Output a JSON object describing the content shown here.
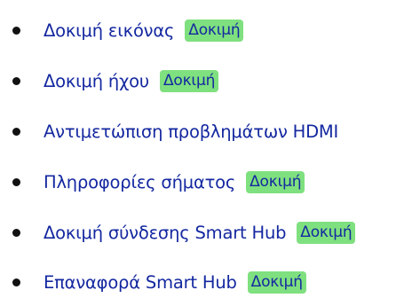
{
  "colors": {
    "link": "#1428a0",
    "badge_background": "#7fe07f",
    "bullet": "#111111"
  },
  "items": [
    {
      "label": "Δοκιμή εικόνας",
      "badge": "Δοκιμή"
    },
    {
      "label": "Δοκιμή ήχου",
      "badge": "Δοκιμή"
    },
    {
      "label": "Αντιμετώπιση προβλημάτων HDMI"
    },
    {
      "label": "Πληροφορίες σήματος",
      "badge": "Δοκιμή"
    },
    {
      "label": "Δοκιμή σύνδεσης Smart Hub",
      "badge": "Δοκιμή"
    },
    {
      "label": "Επαναφορά Smart Hub",
      "badge": "Δοκιμή"
    }
  ]
}
